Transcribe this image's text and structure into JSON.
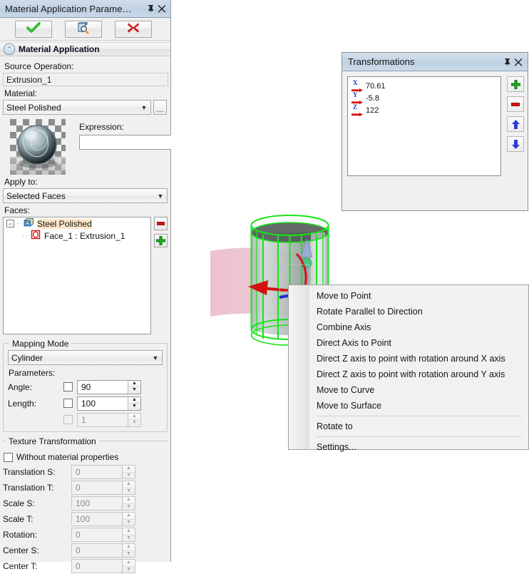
{
  "left_panel": {
    "title": "Material Application Parame…",
    "titlebar_icons": [
      {
        "name": "pin-icon",
        "glyph": "⊼"
      },
      {
        "name": "close-icon",
        "glyph": "✕"
      }
    ],
    "toolbar": [
      {
        "name": "apply-button",
        "icon": "check-icon",
        "label": ""
      },
      {
        "name": "preview-button",
        "icon": "preview-magnifier-icon",
        "label": ""
      },
      {
        "name": "cancel-button",
        "icon": "red-x-icon",
        "label": ""
      }
    ],
    "section": {
      "label": "Material Application",
      "collapse_icon": "double-chevron-up-icon"
    },
    "source_operation": {
      "label": "Source Operation:",
      "value": "Extrusion_1"
    },
    "material": {
      "label": "Material:",
      "value": "Steel Polished",
      "browse_label": "…"
    },
    "expression": {
      "label": "Expression:",
      "value": "",
      "placeholder": ""
    },
    "apply_to": {
      "label": "Apply to:",
      "value": "Selected Faces"
    },
    "faces": {
      "label": "Faces:",
      "tree": [
        {
          "label": "Steel Polished",
          "icon": "material-cube-icon",
          "expanded": true,
          "selected": true
        },
        {
          "label": "Face_1 : Extrusion_1",
          "icon": "face-icon",
          "indent": true,
          "selected": false
        }
      ],
      "remove_button": "remove-face-button",
      "add_button": "add-face-button"
    },
    "mapping_mode": {
      "title": "Mapping Mode",
      "value": "Cylinder",
      "parameters_label": "Parameters:",
      "rows": [
        {
          "label": "Angle:",
          "checked": false,
          "value": "90",
          "disabled": false
        },
        {
          "label": "Length:",
          "checked": false,
          "value": "100",
          "disabled": false
        },
        {
          "label": "",
          "checked": false,
          "value": "1",
          "disabled": true
        }
      ]
    },
    "texture_transformation": {
      "title": "Texture Transformation",
      "without_material_properties": {
        "label": "Without material properties",
        "checked": false
      },
      "rows": [
        {
          "label": "Translation S:",
          "value": "0",
          "disabled": true
        },
        {
          "label": "Translation T:",
          "value": "0",
          "disabled": true
        },
        {
          "label": "Scale S:",
          "value": "100",
          "disabled": true
        },
        {
          "label": "Scale T:",
          "value": "100",
          "disabled": true
        },
        {
          "label": "Rotation:",
          "value": "0",
          "disabled": true
        },
        {
          "label": "Center S:",
          "value": "0",
          "disabled": true
        },
        {
          "label": "Center T:",
          "value": "0",
          "disabled": true
        }
      ]
    }
  },
  "transformations": {
    "title": "Transformations",
    "titlebar_icons": [
      {
        "name": "pin-icon",
        "glyph": "⊼"
      },
      {
        "name": "close-icon",
        "glyph": "✕"
      }
    ],
    "items": [
      {
        "axis": "X",
        "value": "70.61"
      },
      {
        "axis": "Y",
        "value": "-5.8"
      },
      {
        "axis": "Z",
        "value": "122"
      }
    ],
    "side_buttons": [
      {
        "name": "add-transformation-button",
        "icon": "green-plus-icon"
      },
      {
        "name": "remove-transformation-button",
        "icon": "red-minus-icon"
      },
      {
        "name": "move-up-button",
        "icon": "blue-up-arrow-icon"
      },
      {
        "name": "move-down-button",
        "icon": "blue-down-arrow-icon"
      }
    ]
  },
  "context_menu": {
    "items": [
      {
        "label": "Move to Point",
        "separator_after": false
      },
      {
        "label": "Rotate Parallel to Direction",
        "separator_after": false
      },
      {
        "label": "Combine Axis",
        "separator_after": false
      },
      {
        "label": "Direct Axis to Point",
        "separator_after": false
      },
      {
        "label": "Direct Z axis to point with rotation around X axis",
        "separator_after": false
      },
      {
        "label": "Direct Z axis to point with rotation around Y axis",
        "separator_after": false
      },
      {
        "label": "Move to Curve",
        "separator_after": false
      },
      {
        "label": "Move to Surface",
        "separator_after": true
      },
      {
        "label": "Rotate to",
        "separator_after": true
      },
      {
        "label": "Settings...",
        "separator_after": false
      }
    ]
  },
  "viewport": {
    "background": "#ffffff",
    "model": {
      "name": "cylinder-extrusion",
      "wireframe_color": "#19e319",
      "body_color": "#b9c3c0",
      "sweep_color": "#e8a9bc"
    },
    "manipulator": {
      "x_axis_color": "#d51111",
      "y_axis_color": "#1f2fd0",
      "z_axis_color": "#8fa4cf",
      "handle_color": "#30c46a"
    }
  },
  "colors": {
    "titlebar_accent": "#c3d3e4",
    "panel_bg": "#f0f0f0",
    "selection_highlight": "#fce6c8",
    "green": "#19b519",
    "red": "#d51111",
    "blue": "#1f2fd0"
  }
}
